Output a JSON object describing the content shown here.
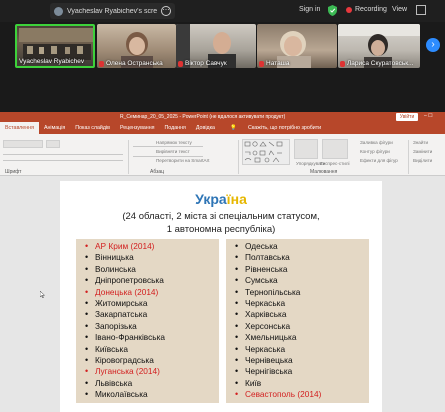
{
  "zoom": {
    "share_title": "Vyacheslav Ryabichev's screen",
    "sign_in": "Sign in",
    "recording": "Recording",
    "view": "View"
  },
  "participants": [
    {
      "name": "Vyacheslav Ryabichev",
      "muted": false
    },
    {
      "name": "Олена Остранська",
      "muted": true
    },
    {
      "name": "Віктор Савчук",
      "muted": true
    },
    {
      "name": "Наташа",
      "muted": true
    },
    {
      "name": "Лариса Скуратовськ...",
      "muted": true
    }
  ],
  "ppt": {
    "title": "R_Семинар_20_05_2025 - PowerPoint (не вдалося активувати продукт)",
    "signin_btn": "Увійти",
    "tabs": [
      "Вставлення",
      "Анімація",
      "Показ слайдів",
      "Рецензування",
      "Подання",
      "Довідка",
      "Скажіть, що потрібно зробити"
    ],
    "active_tab": "Вставлення",
    "ribbon": {
      "font_label": "Шрифт",
      "paragraph_label": "Абзац",
      "drawing_label": "Малювання",
      "text_direction": "Напрямок тексту",
      "align_text": "Вирівняти текст",
      "smartart": "Перетворити на SmartArt",
      "quick_styles": "Експрес-стилі",
      "shape_fill": "Заливка фігури",
      "shape_outline": "Контур фігури",
      "shape_effects": "Ефекти для фігур",
      "find": "Знайти",
      "replace": "Замінити",
      "select": "Виділити",
      "arrange": "Упорядкувати"
    }
  },
  "slide": {
    "title_part1": "Укра",
    "title_part2": "їна",
    "subtitle_line1": "(24 області, 2 міста зі спеціальним статусом,",
    "subtitle_line2": "1 автономна республіка)",
    "left_list": [
      {
        "text": "АР Крим (2014)",
        "red": true
      },
      {
        "text": "Вінницька",
        "red": false
      },
      {
        "text": "Волинська",
        "red": false
      },
      {
        "text": "Дніпропетровська",
        "red": false
      },
      {
        "text": "Донецька (2014)",
        "red": true
      },
      {
        "text": "Житомирська",
        "red": false
      },
      {
        "text": "Закарпатська",
        "red": false
      },
      {
        "text": "Запорізька",
        "red": false
      },
      {
        "text": "Івано-Франківська",
        "red": false
      },
      {
        "text": "Київська",
        "red": false
      },
      {
        "text": "Кіровоградська",
        "red": false
      },
      {
        "text": "Луганська (2014)",
        "red": true
      },
      {
        "text": "Львівська",
        "red": false
      },
      {
        "text": "Миколаївська",
        "red": false
      }
    ],
    "right_list": [
      {
        "text": "Одеська",
        "red": false
      },
      {
        "text": "Полтавська",
        "red": false
      },
      {
        "text": "Рівненська",
        "red": false
      },
      {
        "text": "Сумська",
        "red": false
      },
      {
        "text": "Тернопільська",
        "red": false
      },
      {
        "text": "Черкаська",
        "red": false
      },
      {
        "text": "Харківська",
        "red": false
      },
      {
        "text": "Херсонська",
        "red": false
      },
      {
        "text": "Хмельницька",
        "red": false
      },
      {
        "text": "Черкаська",
        "red": false
      },
      {
        "text": "Чернівецька",
        "red": false
      },
      {
        "text": "Чернігівська",
        "red": false
      },
      {
        "text": "Київ",
        "red": false
      },
      {
        "text": "Севастополь (2014)",
        "red": true
      }
    ]
  }
}
